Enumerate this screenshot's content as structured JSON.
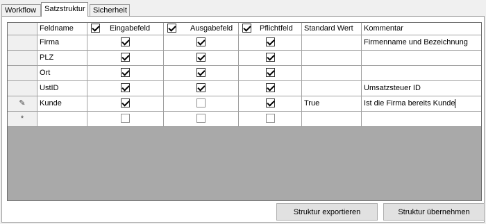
{
  "tabs": [
    {
      "label": "Workflow",
      "active": false
    },
    {
      "label": "Satzstruktur",
      "active": true
    },
    {
      "label": "Sicherheit",
      "active": false
    }
  ],
  "grid": {
    "columns": [
      {
        "label": "",
        "checkbox": false
      },
      {
        "label": "Feldname",
        "checkbox": false
      },
      {
        "label": "Eingabefeld",
        "checkbox": true
      },
      {
        "label": "Ausgabefeld",
        "checkbox": true
      },
      {
        "label": "Pflichtfeld",
        "checkbox": true
      },
      {
        "label": "Standard Wert",
        "checkbox": false
      },
      {
        "label": "Kommentar",
        "checkbox": false
      }
    ],
    "rows": [
      {
        "marker": "",
        "feldname": "Firma",
        "eingabe": true,
        "ausgabe": true,
        "pflicht": true,
        "standard": "",
        "kommentar": "Firmenname und Bezeichnung"
      },
      {
        "marker": "",
        "feldname": "PLZ",
        "eingabe": true,
        "ausgabe": true,
        "pflicht": true,
        "standard": "",
        "kommentar": ""
      },
      {
        "marker": "",
        "feldname": "Ort",
        "eingabe": true,
        "ausgabe": true,
        "pflicht": true,
        "standard": "",
        "kommentar": ""
      },
      {
        "marker": "",
        "feldname": "UstID",
        "eingabe": true,
        "ausgabe": true,
        "pflicht": true,
        "standard": "",
        "kommentar": "Umsatzsteuer ID"
      },
      {
        "marker": "✎",
        "feldname": "Kunde",
        "eingabe": true,
        "ausgabe": false,
        "pflicht": true,
        "standard": "True",
        "kommentar": "Ist die Firma bereits Kunde"
      },
      {
        "marker": "*",
        "feldname": "",
        "eingabe": false,
        "ausgabe": false,
        "pflicht": false,
        "standard": "",
        "kommentar": ""
      }
    ]
  },
  "buttons": {
    "export_label": "Struktur exportieren",
    "apply_label": "Struktur übernehmen"
  }
}
